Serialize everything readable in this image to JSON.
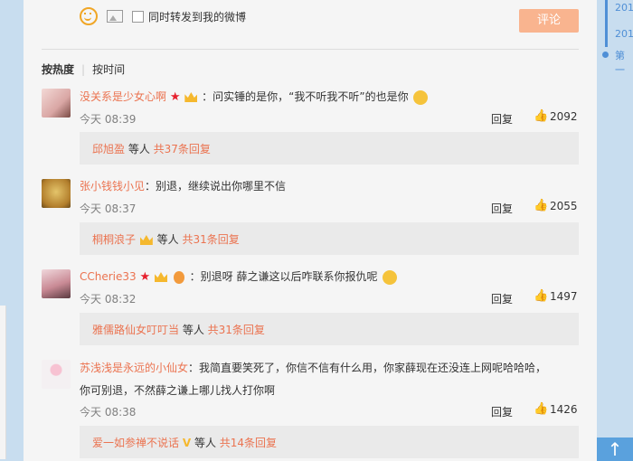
{
  "composer": {
    "forward_label": "同时转发到我的微博",
    "comment_button": "评论"
  },
  "sort": {
    "hot": "按热度",
    "time": "按时间"
  },
  "timeline": {
    "item1": "201",
    "item2": "201",
    "item3": "第一"
  },
  "comments": [
    {
      "user": "没关系是少女心啊",
      "text": "：问实锤的是你，“我不听我不听”的也是你",
      "time": "今天 08:39",
      "reply": "回复",
      "likes": "2092",
      "sub_user": "邱旭盈",
      "sub_mid": " 等人 ",
      "sub_count": "共37条回复"
    },
    {
      "user": "张小钱钱小见",
      "text": "：别退，继续说出你哪里不信",
      "time": "今天 08:37",
      "reply": "回复",
      "likes": "2055",
      "sub_user": "桐桐浪子",
      "sub_mid": " 等人 ",
      "sub_count": "共31条回复"
    },
    {
      "user": "CCherie33",
      "text": "：别退呀 薛之谦这以后咋联系你报仇呢",
      "time": "今天 08:32",
      "reply": "回复",
      "likes": "1497",
      "sub_user": "雅儒路仙女叮叮当",
      "sub_mid": " 等人 ",
      "sub_count": "共31条回复"
    },
    {
      "user": "苏浅浅是永远的小仙女",
      "text": "：我简直要笑死了，你信不信有什么用，你家薛现在还没连上网呢哈哈哈，",
      "text2": "你可别退，不然薛之谦上哪儿找人打你啊",
      "time": "今天 08:38",
      "reply": "回复",
      "likes": "1426",
      "sub_user": "爱一如参禅不说话",
      "sub_mid": " 等人 ",
      "sub_count": "共14条回复"
    }
  ]
}
